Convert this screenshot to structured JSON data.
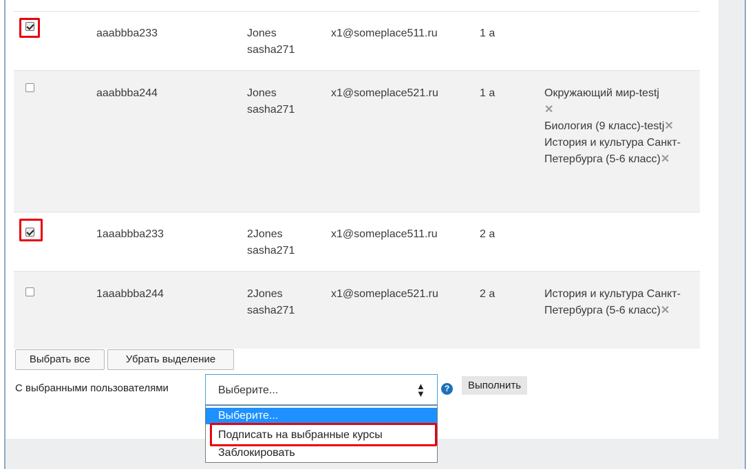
{
  "rows": [
    {
      "checked": true,
      "username": "aaabbba233",
      "first_name": "Jones",
      "last_name": "sasha271",
      "email": "x1@someplace511.ru",
      "class": "1 a",
      "courses": []
    },
    {
      "checked": false,
      "username": "aaabbba244",
      "first_name": "Jones",
      "last_name": "sasha271",
      "email": "x1@someplace521.ru",
      "class": "1 a",
      "courses": [
        "Окружающий мир-testj",
        "Биология (9 класс)-testj",
        "История и культура Санкт-Петербурга (5-6 класс)"
      ]
    },
    {
      "checked": true,
      "username": "1aaabbba233",
      "first_name": "2Jones",
      "last_name": "sasha271",
      "email": "x1@someplace511.ru",
      "class": "2 a",
      "courses": []
    },
    {
      "checked": false,
      "username": "1aaabbba244",
      "first_name": "2Jones",
      "last_name": "sasha271",
      "email": "x1@someplace521.ru",
      "class": "2 a",
      "courses": [
        "История и культура Санкт-Петербурга (5-6 класс)"
      ]
    }
  ],
  "buttons": {
    "select_all": "Выбрать все",
    "deselect": "Убрать выделение",
    "execute": "Выполнить"
  },
  "bulk": {
    "label": "С выбранными пользователями",
    "selected_value": "Выберите...",
    "options": [
      "Выберите...",
      "Подписать на выбранные курсы",
      "Заблокировать"
    ]
  },
  "icons": {
    "remove": "close-x-icon",
    "help": "question-circle-icon",
    "sort": "sort-arrows-icon"
  },
  "colors": {
    "highlight_box": "#e8000b",
    "option_selected": "#1e90ff",
    "help_icon": "#1d71b8"
  }
}
